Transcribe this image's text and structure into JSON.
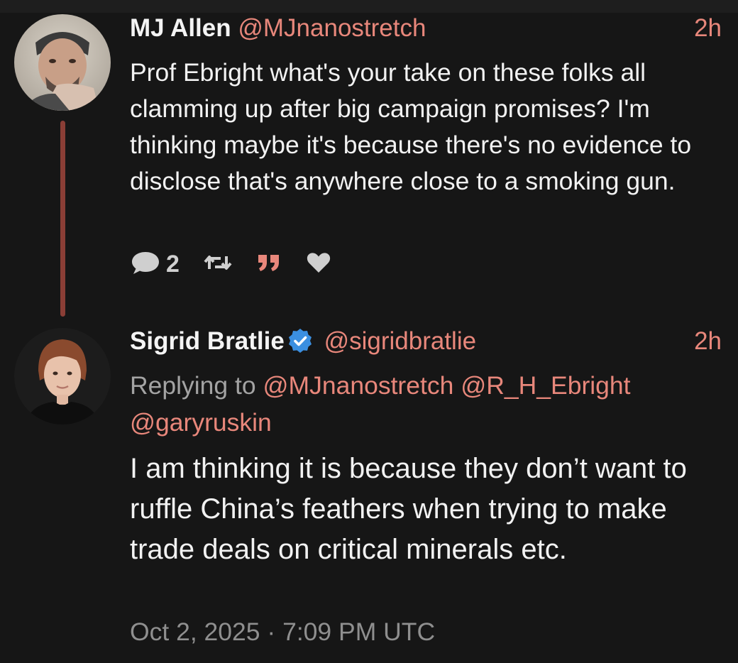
{
  "tweet1": {
    "name": "MJ Allen",
    "handle": "@MJnanostretch",
    "time": "2h",
    "text": "Prof Ebright what's your take on these folks all clamming up after big campaign promises? I'm thinking maybe it's because there's no evidence to disclose that's anywhere close to a smoking gun.",
    "reply_count": "2"
  },
  "tweet2": {
    "name": "Sigrid Bratlie",
    "handle": "@sigridbratlie",
    "time": "2h",
    "replying_prefix": "Replying to",
    "replying_to": [
      "@MJnanostretch",
      "@R_H_Ebright",
      "@garyruskin"
    ],
    "text": "I am thinking it is because they don’t want to ruffle China’s feathers when trying to make trade deals on critical minerals etc.",
    "date": "Oct 2, 2025 · 7:09 PM UTC"
  },
  "icons": {
    "reply": "comment-bubble",
    "retweet": "retweet-arrows",
    "quote": "quote-marks",
    "like": "heart",
    "verified": "verified-badge"
  },
  "colors": {
    "background": "#161616",
    "accent": "#e8877b",
    "thread_line": "#8a3e36",
    "verified": "#3b8fe0",
    "muted": "#a3a3a3"
  }
}
